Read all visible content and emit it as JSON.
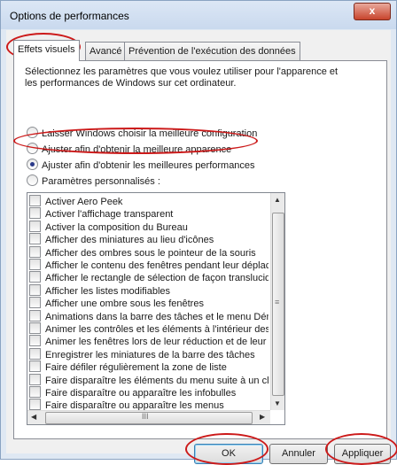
{
  "window": {
    "title": "Options de performances",
    "close_glyph": "x"
  },
  "tabs": [
    {
      "label": "Effets visuels",
      "active": true
    },
    {
      "label": "Avancé",
      "active": false
    },
    {
      "label": "Prévention de l'exécution des données",
      "active": false
    }
  ],
  "description": "Sélectionnez les paramètres que vous voulez utiliser pour l'apparence et les performances de Windows sur cet ordinateur.",
  "radios": [
    {
      "label": "Laisser Windows choisir la meilleure configuration",
      "selected": false
    },
    {
      "label": "Ajuster afin d'obtenir la meilleure apparence",
      "selected": false
    },
    {
      "label": "Ajuster afin d'obtenir les meilleures performances",
      "selected": true
    },
    {
      "label": "Paramètres personnalisés :",
      "selected": false
    }
  ],
  "options": [
    "Activer Aero Peek",
    "Activer l'affichage transparent",
    "Activer la composition du Bureau",
    "Afficher des miniatures au lieu d'icônes",
    "Afficher des ombres sous le pointeur de la souris",
    "Afficher le contenu des fenêtres pendant leur déplacement",
    "Afficher le rectangle de sélection de façon translucide",
    "Afficher les listes modifiables",
    "Afficher une ombre sous les fenêtres",
    "Animations dans la barre des tâches et le menu Démarrer",
    "Animer les contrôles et les éléments à l'intérieur des fenêtres",
    "Animer les fenêtres lors de leur réduction et de leur agrandissement",
    "Enregistrer les miniatures de la barre des tâches",
    "Faire défiler régulièrement la zone de liste",
    "Faire disparaître les éléments du menu suite à un clic",
    "Faire disparaître ou apparaître les infobulles",
    "Faire disparaître ou apparaître les menus"
  ],
  "scroll": {
    "h_middle": "III",
    "v_middle": "≡"
  },
  "buttons": {
    "ok": "OK",
    "cancel": "Annuler",
    "apply": "Appliquer"
  },
  "colors": {
    "annotation": "#cc1a1a",
    "title_bar": "#c9d9ee"
  }
}
